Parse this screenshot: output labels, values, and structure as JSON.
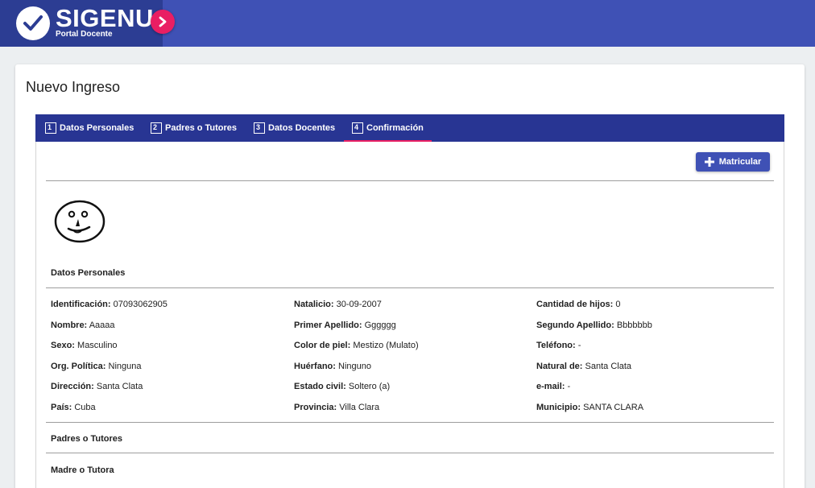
{
  "brand": {
    "name": "SIGENU",
    "subtitle": "Portal Docente"
  },
  "page": {
    "title": "Nuevo Ingreso"
  },
  "tabs": [
    {
      "number": "1",
      "label": "Datos Personales"
    },
    {
      "number": "2",
      "label": "Padres o Tutores"
    },
    {
      "number": "3",
      "label": "Datos Docentes"
    },
    {
      "number": "4",
      "label": "Confirmación"
    }
  ],
  "active_tab": "Confirmación",
  "actions": {
    "matricular_label": "Matricular"
  },
  "sections": {
    "datos_personales": "Datos Personales",
    "padres_tutores": "Padres o Tutores",
    "madre_tutora": "Madre o Tutora"
  },
  "fields": [
    {
      "label": "Identificación:",
      "value": "07093062905"
    },
    {
      "label": "Natalicio:",
      "value": "30-09-2007"
    },
    {
      "label": "Cantidad de hijos:",
      "value": "0"
    },
    {
      "label": "Nombre:",
      "value": "Aaaaa"
    },
    {
      "label": "Primer Apellido:",
      "value": "Gggggg"
    },
    {
      "label": "Segundo Apellido:",
      "value": "Bbbbbbb"
    },
    {
      "label": "Sexo:",
      "value": "Masculino"
    },
    {
      "label": "Color de piel:",
      "value": "Mestizo (Mulato)"
    },
    {
      "label": "Teléfono:",
      "value": "-"
    },
    {
      "label": "Org. Política:",
      "value": "Ninguna"
    },
    {
      "label": "Huérfano:",
      "value": "Ninguno"
    },
    {
      "label": "Natural de:",
      "value": "Santa Clata"
    },
    {
      "label": "Dirección:",
      "value": "Santa Clata"
    },
    {
      "label": "Estado civil:",
      "value": "Soltero (a)"
    },
    {
      "label": "e-mail:",
      "value": "-"
    },
    {
      "label": "País:",
      "value": "Cuba"
    },
    {
      "label": "Provincia:",
      "value": "Villa Clara"
    },
    {
      "label": "Municipio:",
      "value": "SANTA CLARA"
    }
  ],
  "colors": {
    "header": "#3f51b5",
    "brand_block": "#2c3d93",
    "tab_bar": "#283593",
    "accent": "#e91e63",
    "button": "#3f51b5"
  },
  "icons": {
    "brand": "check-circle-icon",
    "brand_nav": "chevron-right-icon",
    "tab_numbers": "numbered-box-icon",
    "matricular": "plus-icon",
    "photo": "face-drawing"
  }
}
